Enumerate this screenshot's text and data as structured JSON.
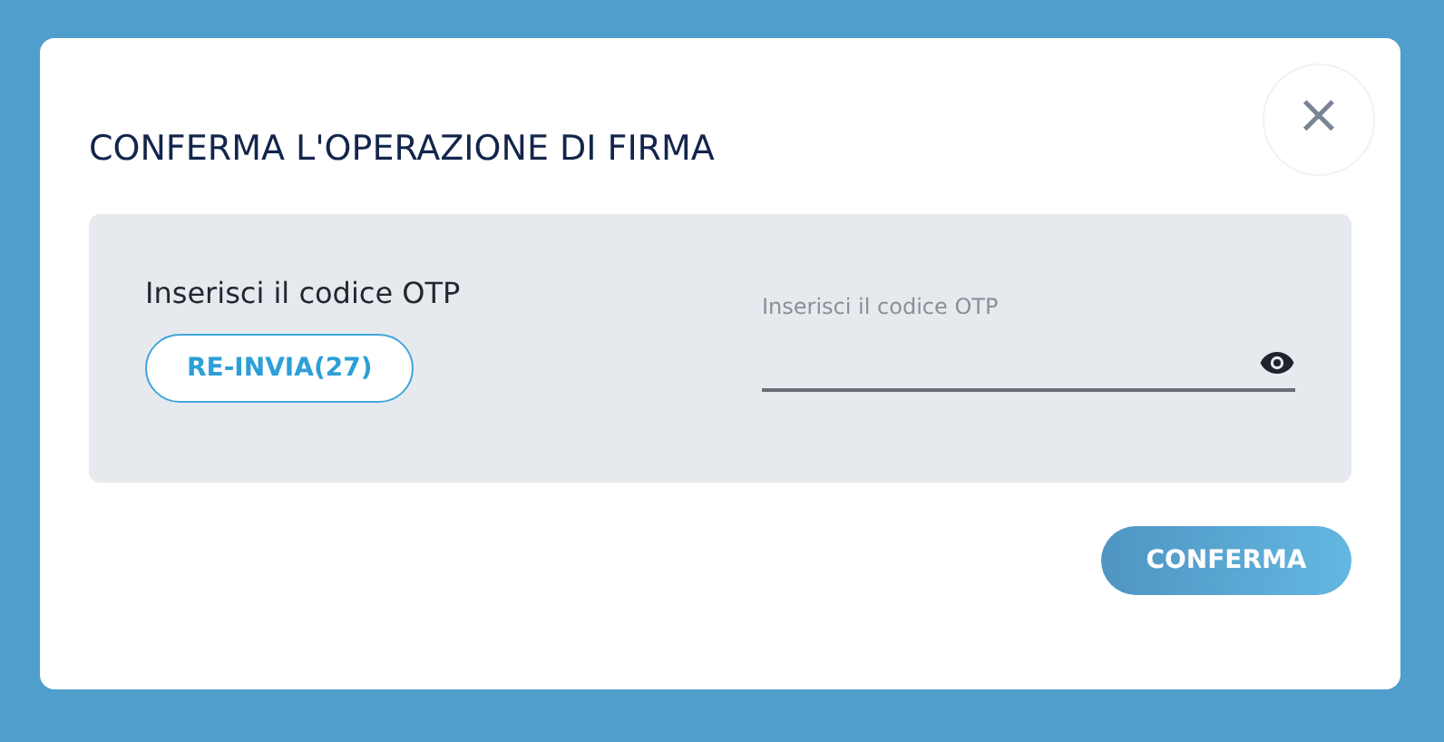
{
  "dialog": {
    "title": "CONFERMA L'OPERAZIONE DI FIRMA",
    "close_label": "×",
    "otp": {
      "label": "Inserisci il codice OTP",
      "resend_button": "RE-INVIA(27)",
      "field_label": "Inserisci il codice OTP"
    },
    "confirm_button": "CONFERMA"
  }
}
